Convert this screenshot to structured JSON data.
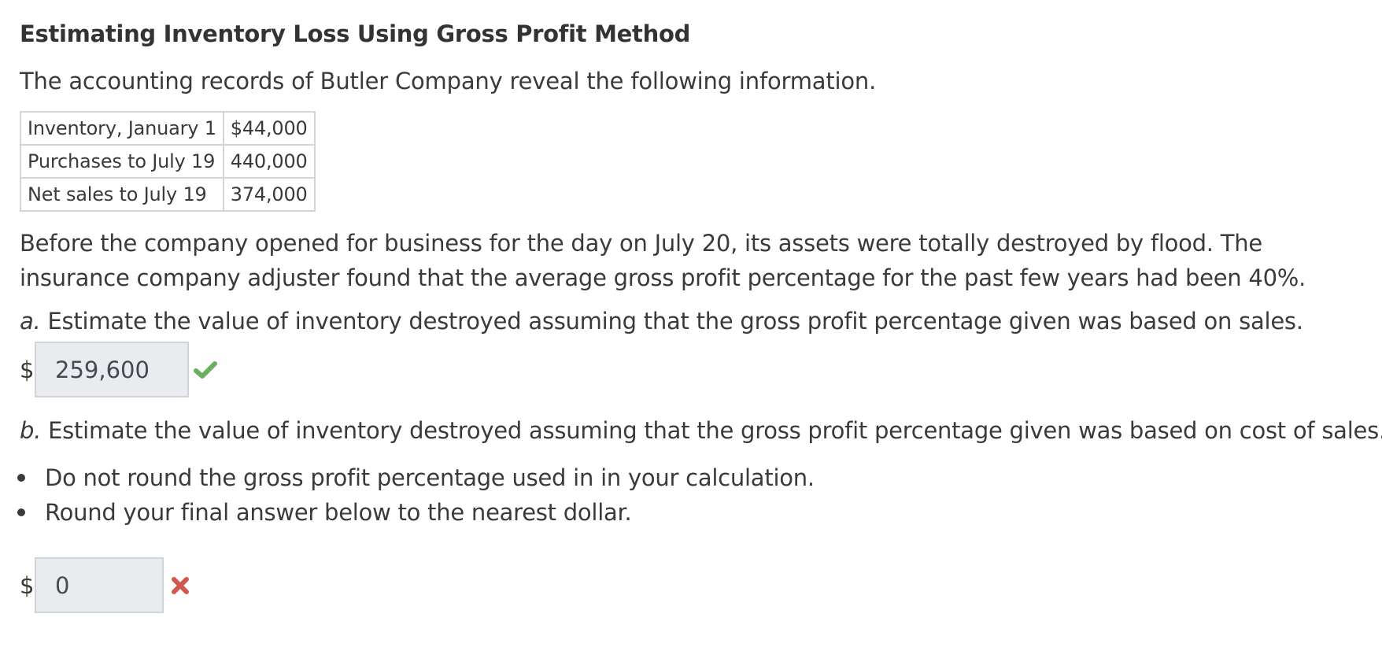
{
  "title": "Estimating Inventory Loss Using Gross Profit Method",
  "intro": "The accounting records of Butler Company reveal the following information.",
  "records_table": {
    "rows": [
      {
        "label": "Inventory, January 1",
        "value": "$44,000"
      },
      {
        "label": "Purchases to July 19",
        "value": "440,000"
      },
      {
        "label": "Net sales to July 19",
        "value": "374,000"
      }
    ]
  },
  "scenario": "Before the company opened for business for the day on July 20, its assets were totally destroyed by flood. The insurance company adjuster found that the average gross profit percentage for the past few years had been 40%.",
  "part_a": {
    "letter": "a.",
    "question": " Estimate the value of inventory destroyed assuming that the gross profit percentage given was based on sales.",
    "currency": "$",
    "answer": "259,600",
    "status": "correct",
    "status_icon": "check-icon",
    "status_color": "#6aaf5e"
  },
  "part_b": {
    "letter": "b.",
    "question": " Estimate the value of inventory destroyed assuming that the gross profit percentage given was based on cost of sales.",
    "instructions": [
      "Do not round the gross profit percentage used in in your calculation.",
      "Round your final answer below to the nearest dollar."
    ],
    "currency": "$",
    "answer": "0",
    "status": "incorrect",
    "status_icon": "x-icon",
    "status_color": "#d0594f"
  }
}
